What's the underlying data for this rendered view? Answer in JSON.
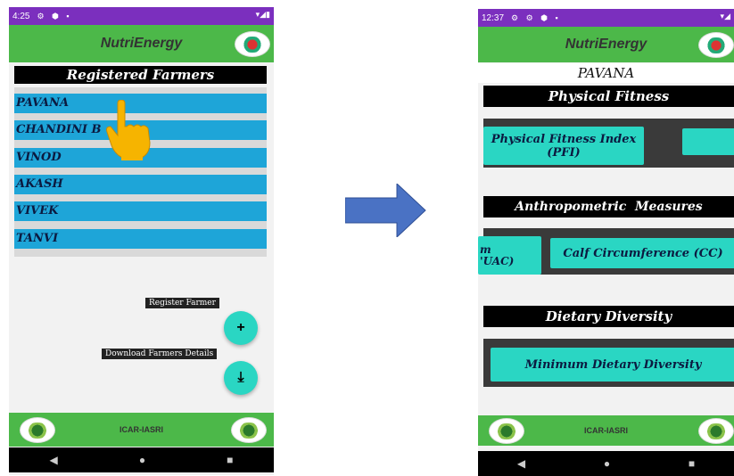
{
  "colors": {
    "statusbar": "#7b2fbe",
    "appbar": "#4cb849",
    "row": "#1ea5d8",
    "teal": "#2ad6c3",
    "arrow": "#4a72c4"
  },
  "phone1": {
    "status": {
      "time": "4:25",
      "icons": "⚙ ⬢ ▪",
      "right": "▾◢▮"
    },
    "app_title": "NutriEnergy",
    "heading": "Registered Farmers",
    "farmers": [
      "PAVANA",
      "CHANDINI B",
      "VINOD",
      "AKASH",
      "VIVEK",
      "TANVI"
    ],
    "register_label": "Register Farmer",
    "register_icon": "+",
    "download_label": "Download Farmers Details",
    "download_icon": "⤓",
    "footer_text": "ICAR-IASRI",
    "nav": {
      "back": "◀",
      "home": "●",
      "recent": "■"
    }
  },
  "phone2": {
    "status": {
      "time": "12:37",
      "icons": "⚙ ⚙ ⬢ ▪",
      "right": "▾◢"
    },
    "app_title": "NutriEnergy",
    "farmer_name": "PAVANA",
    "sections": [
      {
        "title": "Physical Fitness",
        "buttons": [
          "Physical Fitness Index (PFI)",
          ""
        ]
      },
      {
        "title": "Anthropometric  Measures",
        "buttons": [
          "m\n'UAC)",
          "Calf Circumference (CC)"
        ]
      },
      {
        "title": "Dietary Diversity",
        "buttons": [
          "Minimum Dietary Diversity"
        ]
      }
    ],
    "footer_text": "ICAR-IASRI",
    "nav": {
      "back": "◀",
      "home": "●",
      "recent": "■"
    }
  }
}
